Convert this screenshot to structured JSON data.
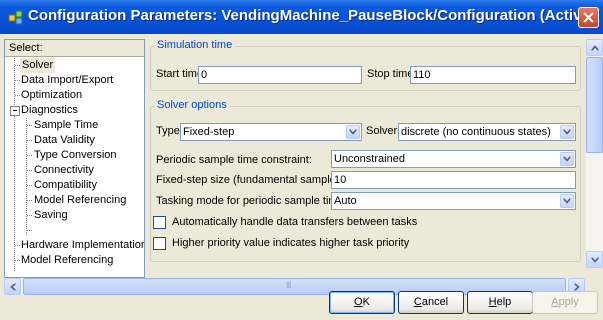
{
  "window": {
    "title": "Configuration Parameters: VendingMachine_PauseBlock/Configuration (Active)",
    "title_bar_color": "#0a54e0"
  },
  "icons": {
    "app": "simulink-config-icon",
    "close": "close-icon",
    "tree_expander": "minus-box-icon",
    "scroll_left": "arrow-left-icon",
    "scroll_right": "arrow-right-icon",
    "scroll_up": "arrow-up-icon",
    "scroll_down": "arrow-down-icon",
    "dropdown": "chevron-down-icon"
  },
  "tree": {
    "header": "Select:",
    "items": [
      {
        "label": "Solver",
        "selected": true
      },
      {
        "label": "Data Import/Export"
      },
      {
        "label": "Optimization"
      },
      {
        "label": "Diagnostics",
        "expanded": true
      },
      {
        "label": "Sample Time"
      },
      {
        "label": "Data Validity"
      },
      {
        "label": "Type Conversion"
      },
      {
        "label": "Connectivity"
      },
      {
        "label": "Compatibility"
      },
      {
        "label": "Model Referencing"
      },
      {
        "label": "Saving"
      },
      {
        "label": "Hardware Implementation"
      },
      {
        "label": "Model Referencing"
      }
    ]
  },
  "simulation_time": {
    "title": "Simulation time",
    "start_label": "Start time:",
    "start_value": "0",
    "stop_label": "Stop time:",
    "stop_value": "110"
  },
  "solver_options": {
    "title": "Solver options",
    "type_label": "Type:",
    "type_value": "Fixed-step",
    "solver_label": "Solver:",
    "solver_value": "discrete (no continuous states)",
    "periodic_label": "Periodic sample time constraint:",
    "periodic_value": "Unconstrained",
    "step_size_label": "Fixed-step size (fundamental sample time):",
    "step_size_value": "10",
    "tasking_label": "Tasking mode for periodic sample times:",
    "tasking_value": "Auto",
    "auto_transfer_label": "Automatically handle data transfers between tasks",
    "auto_transfer_checked": false,
    "priority_label": "Higher priority value indicates higher task priority",
    "priority_checked": false
  },
  "buttons": {
    "ok_mnemonic": "O",
    "ok_rest": "K",
    "cancel_mnemonic": "C",
    "cancel_rest": "ancel",
    "help_mnemonic": "H",
    "help_rest": "elp",
    "apply_mnemonic": "A",
    "apply_rest": "pply"
  },
  "scrollbar": {
    "grip": "III"
  }
}
